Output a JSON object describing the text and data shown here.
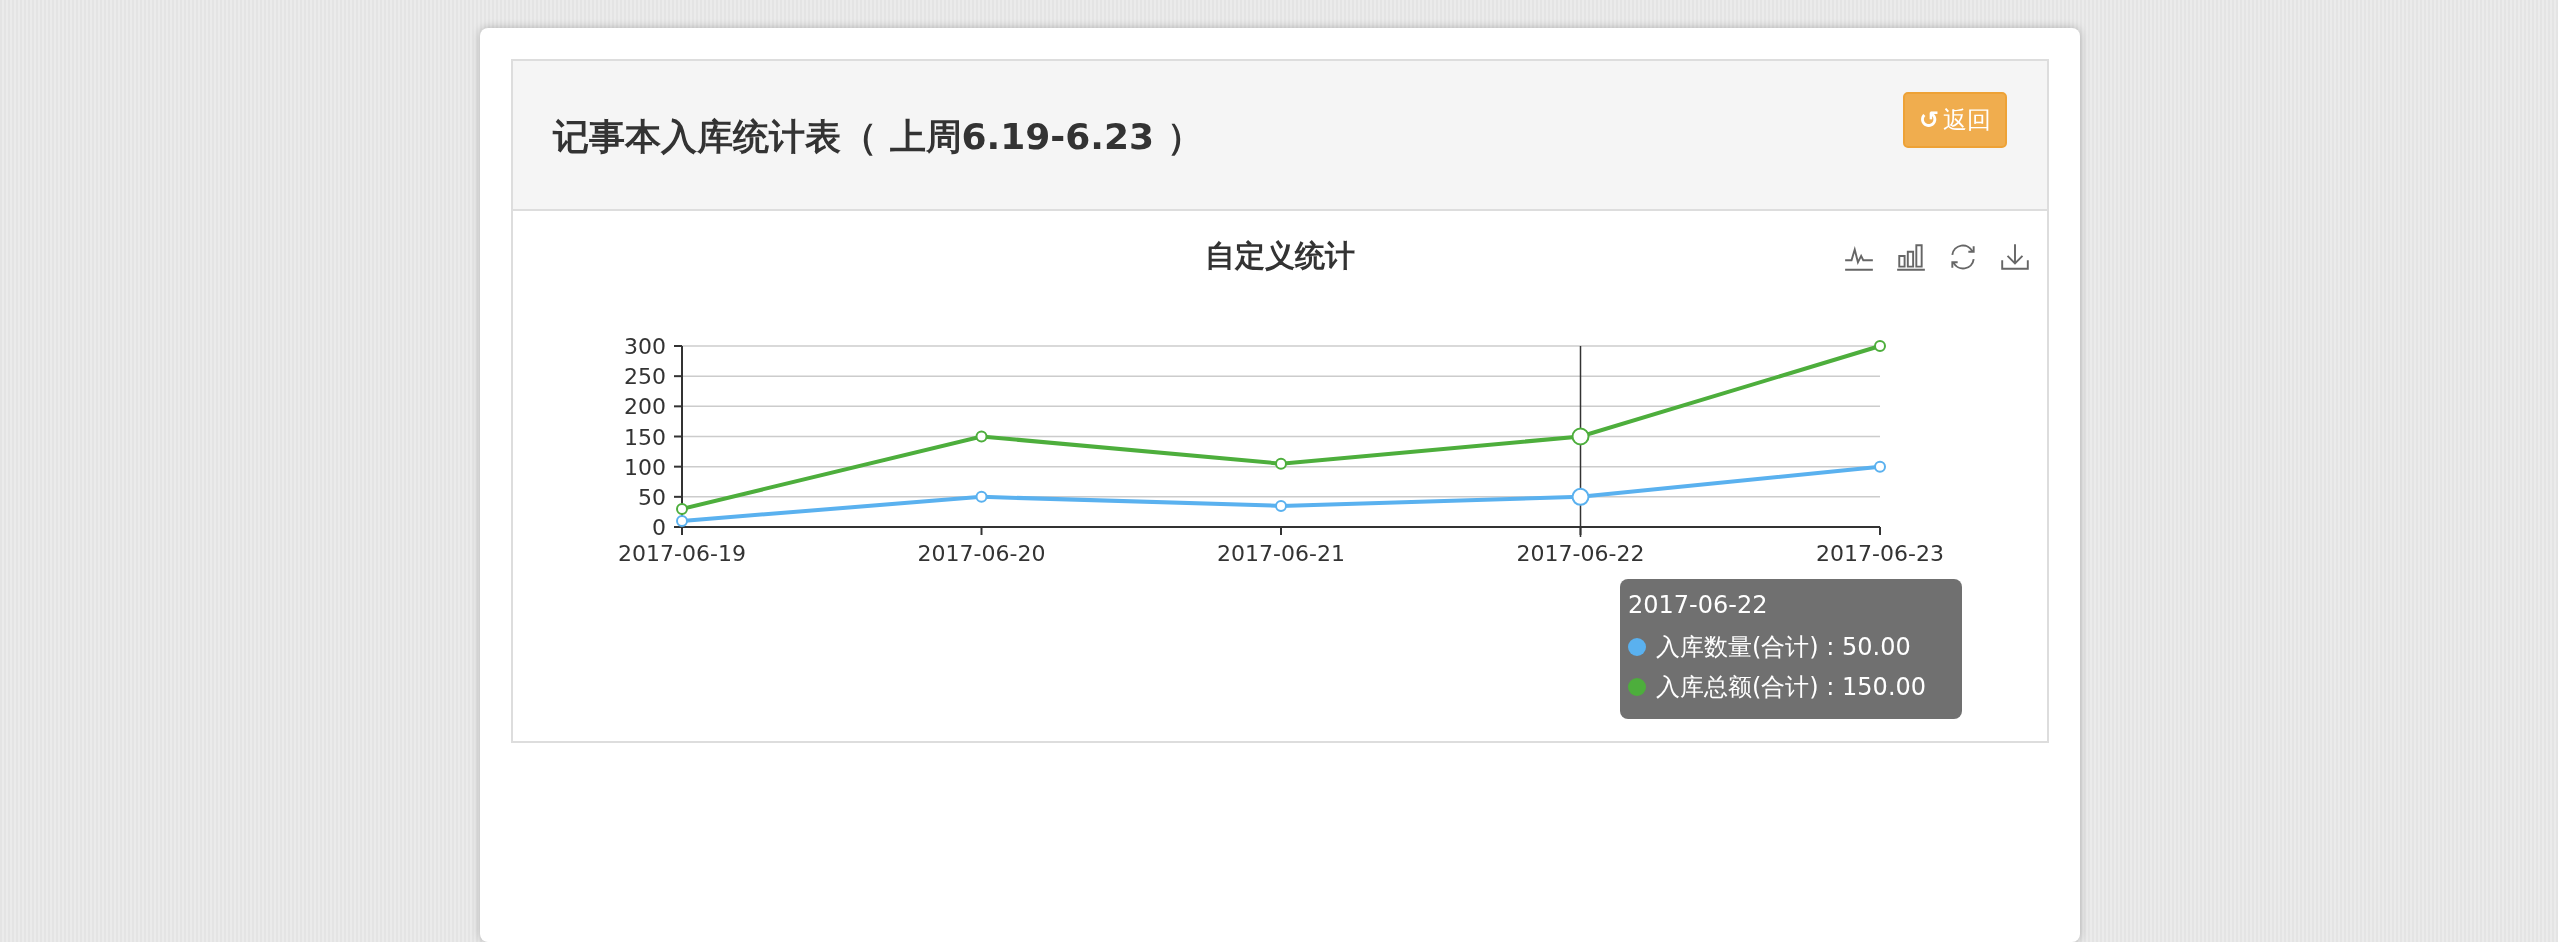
{
  "panel": {
    "title": "记事本入库统计表（ 上周6.19-6.23 ）",
    "back_button": {
      "icon": "↺",
      "label": "返回"
    }
  },
  "chart": {
    "toolbar": [
      {
        "kind": "line"
      },
      {
        "kind": "bar"
      },
      {
        "kind": "restore"
      },
      {
        "kind": "download"
      }
    ],
    "chart_data": {
      "type": "line",
      "title": "自定义统计",
      "categories": [
        "2017-06-19",
        "2017-06-20",
        "2017-06-21",
        "2017-06-22",
        "2017-06-23"
      ],
      "series": [
        {
          "name": "入库数量(合计)",
          "color": "#5ab1ef",
          "marker": "circle",
          "values": [
            10,
            50,
            35,
            50,
            100
          ]
        },
        {
          "name": "入库总额(合计)",
          "color": "#4dae3c",
          "marker": "circle",
          "values": [
            30,
            150,
            105,
            150,
            300
          ]
        }
      ],
      "ylim": [
        0,
        300
      ],
      "yticks": [
        0,
        50,
        100,
        150,
        200,
        250,
        300
      ],
      "grid": true,
      "ref_lines": [
        {
          "axis": "x",
          "value": "2017-06-22"
        }
      ]
    },
    "tooltip": {
      "title": "2017-06-22",
      "items": [
        {
          "value": ": 50.00"
        },
        {
          "value": ": 150.00"
        }
      ]
    }
  }
}
